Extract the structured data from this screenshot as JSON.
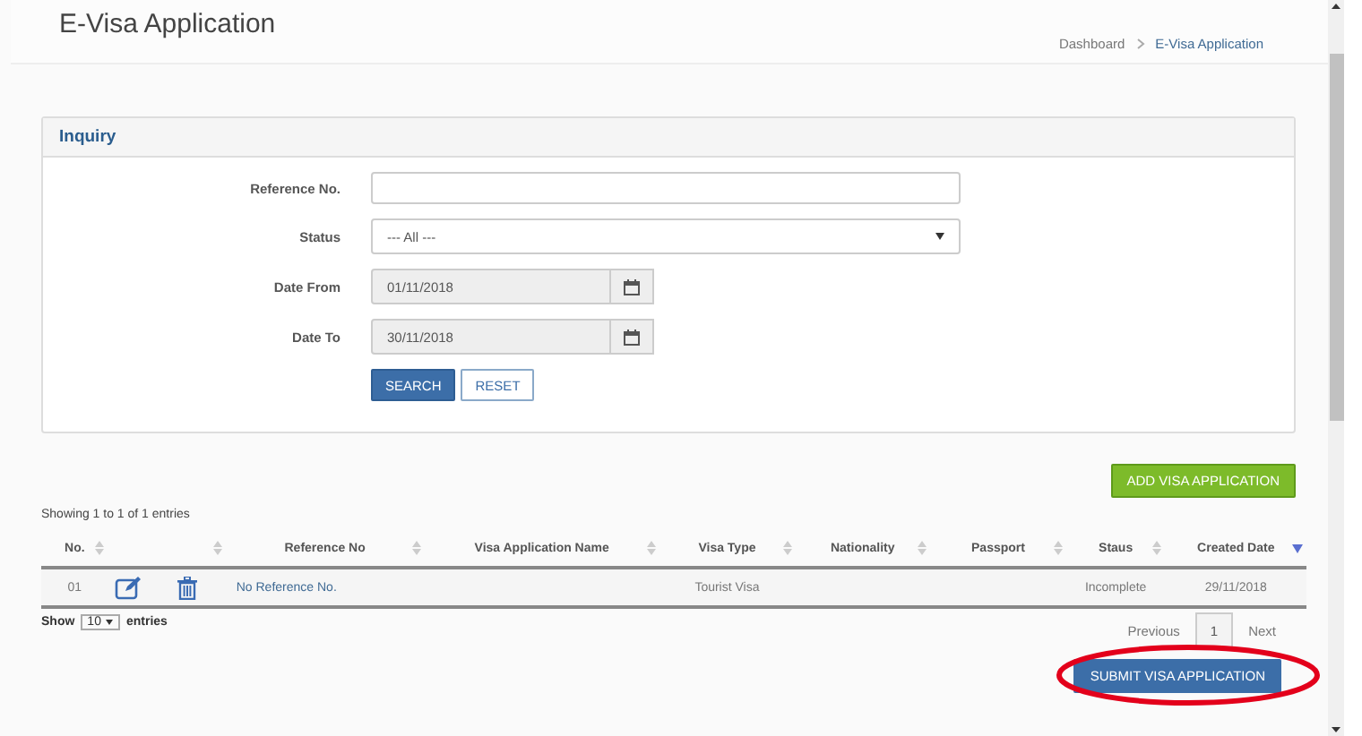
{
  "page_title": "E-Visa Application",
  "breadcrumb": [
    {
      "label": "Dashboard",
      "selected": false
    },
    {
      "label": "E-Visa Application",
      "selected": true
    }
  ],
  "inquiry": {
    "title": "Inquiry",
    "fields": [
      {
        "kind": "text",
        "label": "Reference No."
      },
      {
        "kind": "select",
        "label": "Status",
        "value": "--- All ---"
      },
      {
        "kind": "date",
        "label": "Date From",
        "value": "01/11/2018"
      },
      {
        "kind": "date",
        "label": "Date To",
        "value": "30/11/2018"
      }
    ],
    "buttons": [
      {
        "label": "SEARCH",
        "kind": "primary"
      },
      {
        "label": "RESET",
        "kind": "outline"
      }
    ]
  },
  "add_button": "ADD VISA APPLICATION",
  "showing": "Showing 1 to 1 of 1 entries",
  "table": {
    "columns": [
      {
        "label": "No.",
        "sorted_desc": false
      },
      {
        "sorted_desc": false
      },
      {
        "label": "Reference No",
        "sorted_desc": false
      },
      {
        "label": "Visa Application Name",
        "sorted_desc": false
      },
      {
        "label": "Visa Type",
        "sorted_desc": false
      },
      {
        "label": "Nationality",
        "sorted_desc": false
      },
      {
        "label": "Passport",
        "sorted_desc": false
      },
      {
        "label": "Staus",
        "sorted_desc": false
      },
      {
        "label": "Created Date",
        "sorted_desc": true
      }
    ],
    "rows": [
      {
        "no": "01",
        "reference_no": "No Reference No.",
        "visa_type": "Tourist Visa",
        "status": "Incomplete",
        "created_date": "29/11/2018"
      }
    ]
  },
  "page_size": {
    "before": "Show",
    "value": "10",
    "after": "entries"
  },
  "pagination": {
    "previous": "Previous",
    "pages": [
      {
        "label": "1",
        "selected": true
      }
    ],
    "next": "Next"
  },
  "submit_button": {
    "label": "SUBMIT VISA APPLICATION",
    "highlighted": true
  }
}
